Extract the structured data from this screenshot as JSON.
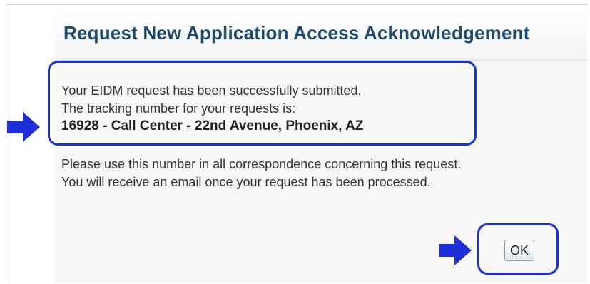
{
  "dialog": {
    "title": "Request New Application Access Acknowledgement"
  },
  "message": {
    "line1": "Your EIDM request has been successfully submitted.",
    "line2": "The tracking number for your requests is:",
    "tracking": "16928 - Call Center - 22nd Avenue, Phoenix, AZ",
    "info1": "Please use this number in all correspondence concerning this request.",
    "info2": "You will receive an email once your request has been processed."
  },
  "actions": {
    "ok_label": "OK"
  },
  "colors": {
    "highlight": "#1e2fd8",
    "title": "#1e4a6e"
  },
  "icons": {
    "left_arrow": "right-arrow-icon",
    "ok_arrow": "right-arrow-icon"
  }
}
